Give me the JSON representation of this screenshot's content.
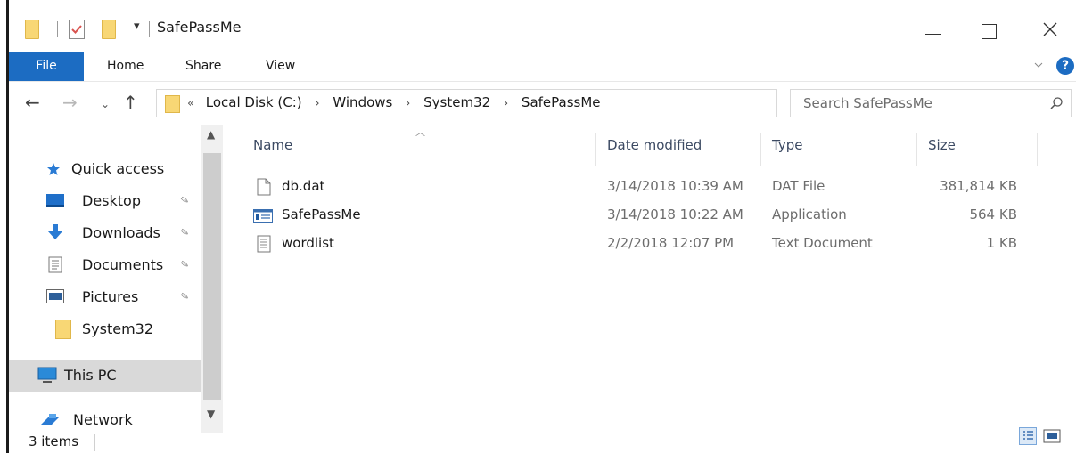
{
  "window": {
    "title": "SafePassMe",
    "controls": {
      "minimize_icon": "minimize-icon",
      "maximize_icon": "maximize-icon",
      "close_icon": "close-icon"
    }
  },
  "ribbon": {
    "tabs": [
      {
        "label": "File",
        "active": true
      },
      {
        "label": "Home"
      },
      {
        "label": "Share"
      },
      {
        "label": "View"
      }
    ],
    "help_label": "?"
  },
  "address": {
    "prefix": "«",
    "crumbs": [
      "Local Disk (C:)",
      "Windows",
      "System32",
      "SafePassMe"
    ],
    "search_placeholder": "Search SafePassMe"
  },
  "sidebar": {
    "items": [
      {
        "label": "Quick access",
        "icon": "star-icon"
      },
      {
        "label": "Desktop",
        "icon": "desktop-icon",
        "pinned": true
      },
      {
        "label": "Downloads",
        "icon": "download-icon",
        "pinned": true
      },
      {
        "label": "Documents",
        "icon": "documents-icon",
        "pinned": true
      },
      {
        "label": "Pictures",
        "icon": "pictures-icon",
        "pinned": true
      },
      {
        "label": "System32",
        "icon": "folder-icon"
      },
      {
        "label": "This PC",
        "icon": "computer-icon",
        "selected": true
      },
      {
        "label": "Network",
        "icon": "network-icon"
      }
    ]
  },
  "files": {
    "columns": {
      "name": "Name",
      "date": "Date modified",
      "type": "Type",
      "size": "Size"
    },
    "rows": [
      {
        "name": "db.dat",
        "date": "3/14/2018 10:39 AM",
        "type": "DAT File",
        "size": "381,814 KB",
        "icon": "file-icon"
      },
      {
        "name": "SafePassMe",
        "date": "3/14/2018 10:22 AM",
        "type": "Application",
        "size": "564 KB",
        "icon": "application-icon"
      },
      {
        "name": "wordlist",
        "date": "2/2/2018 12:07 PM",
        "type": "Text Document",
        "size": "1 KB",
        "icon": "text-document-icon"
      }
    ]
  },
  "status": {
    "items_count": "3 items"
  },
  "colors": {
    "accent": "#1c6cc2",
    "folder": "#f8d775",
    "selected": "#d9d9d9"
  }
}
